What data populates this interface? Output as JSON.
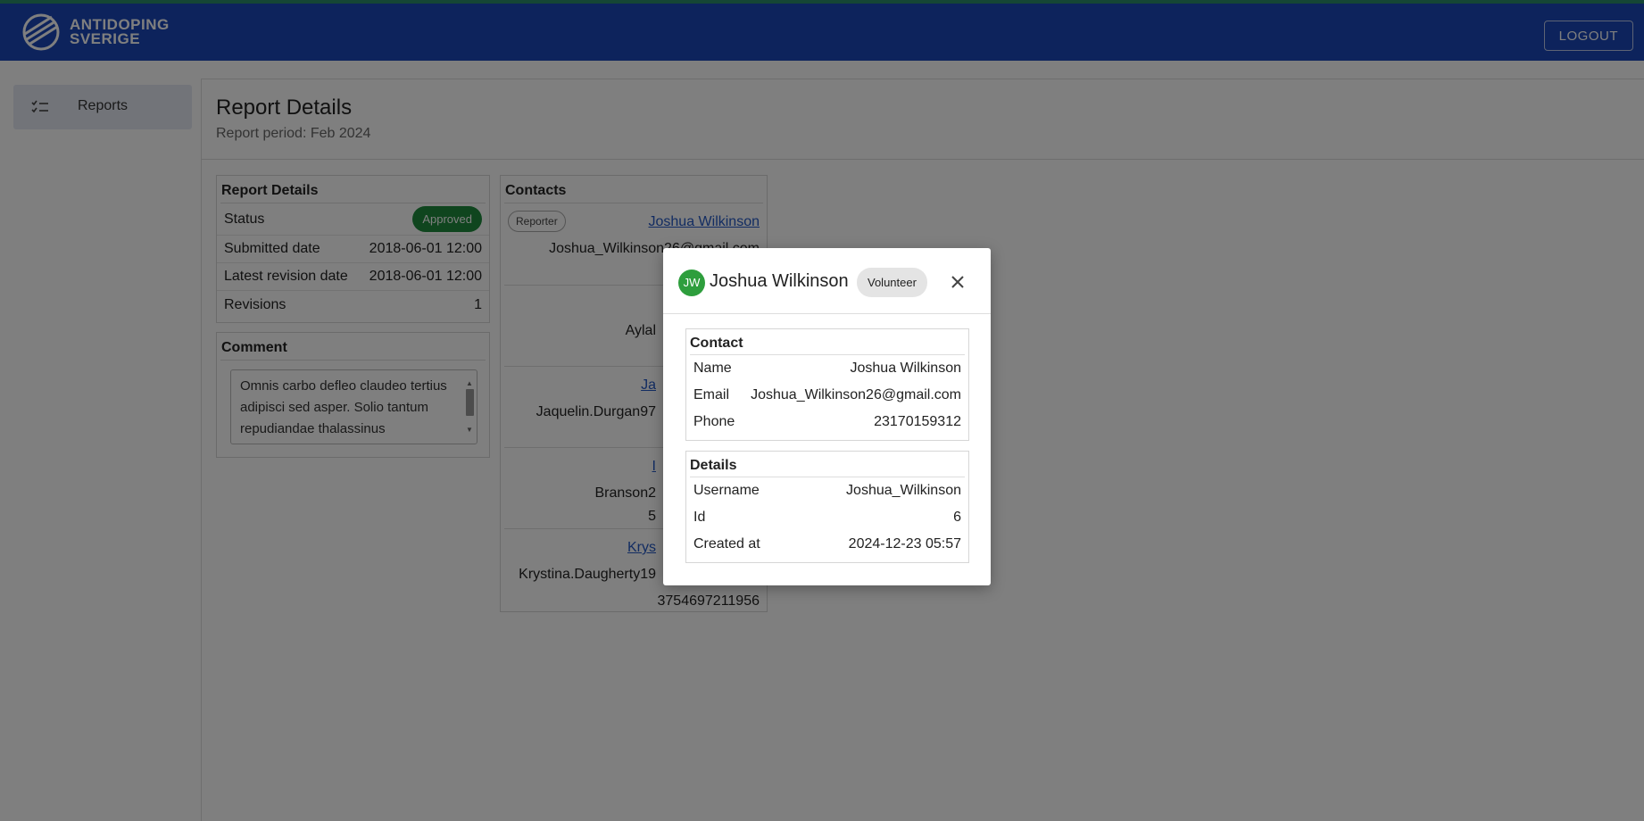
{
  "header": {
    "logo_line1": "ANTIDOPING",
    "logo_line2": "SVERIGE",
    "logout_label": "LOGOUT"
  },
  "sidebar": {
    "items": [
      {
        "label": "Reports",
        "icon": "checklist-icon"
      }
    ]
  },
  "main": {
    "title": "Report Details",
    "subtitle": "Report period: Feb 2024",
    "report_details": {
      "title": "Report Details",
      "rows": [
        {
          "label": "Status",
          "value": "Approved"
        },
        {
          "label": "Submitted date",
          "value": "2018-06-01 12:00"
        },
        {
          "label": "Latest revision date",
          "value": "2018-06-01 12:00"
        },
        {
          "label": "Revisions",
          "value": "1"
        }
      ]
    },
    "comment": {
      "title": "Comment",
      "text": "Omnis carbo defleo claudeo tertius adipisci sed asper. Solio tantum repudiandae thalassinus"
    },
    "contacts": {
      "title": "Contacts",
      "items": [
        {
          "role": "Reporter",
          "name": "Joshua Wilkinson",
          "email": "Joshua_Wilkinson26@gmail.com",
          "phone": ""
        },
        {
          "name": "",
          "email": "Aylal",
          "phone": ""
        },
        {
          "name": "Ja",
          "email": "Jaquelin.Durgan97",
          "phone": ""
        },
        {
          "name": "I",
          "email": "Branson2",
          "phone": "5"
        },
        {
          "name": "Krys",
          "email": "Krystina.Daugherty19",
          "phone": "3754697211956"
        }
      ]
    }
  },
  "modal": {
    "avatar_initials": "JW",
    "name": "Joshua Wilkinson",
    "role_chip": "Volunteer",
    "contact": {
      "title": "Contact",
      "rows": [
        {
          "label": "Name",
          "value": "Joshua Wilkinson"
        },
        {
          "label": "Email",
          "value": "Joshua_Wilkinson26@gmail.com"
        },
        {
          "label": "Phone",
          "value": "23170159312"
        }
      ]
    },
    "details": {
      "title": "Details",
      "rows": [
        {
          "label": "Username",
          "value": "Joshua_Wilkinson"
        },
        {
          "label": "Id",
          "value": "6"
        },
        {
          "label": "Created at",
          "value": "2024-12-23 05:57"
        }
      ]
    }
  },
  "colors": {
    "header_bg": "#1a47b8",
    "approved": "#1e8a3c",
    "avatar": "#2e9e3d",
    "link": "#2458c4"
  }
}
